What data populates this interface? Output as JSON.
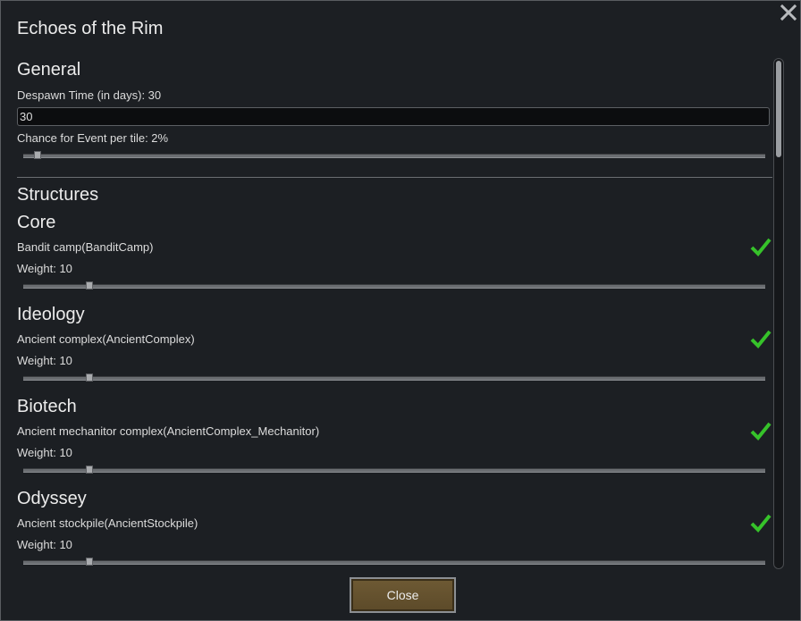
{
  "window": {
    "title": "Echoes of the Rim"
  },
  "general": {
    "heading": "General",
    "despawn_label": "Despawn Time (in days): 30",
    "despawn_value": "30",
    "chance_label": "Chance for Event per tile: 2%",
    "chance_level": 0.02
  },
  "structures": {
    "heading": "Structures",
    "groups": [
      {
        "heading": "Core",
        "item": "Bandit camp(BanditCamp)",
        "weight_label": "Weight: 10",
        "enabled": true
      },
      {
        "heading": "Ideology",
        "item": "Ancient complex(AncientComplex)",
        "weight_label": "Weight: 10",
        "enabled": true
      },
      {
        "heading": "Biotech",
        "item": "Ancient mechanitor complex(AncientComplex_Mechanitor)",
        "weight_label": "Weight: 10",
        "enabled": true
      },
      {
        "heading": "Odyssey",
        "item": "Ancient stockpile(AncientStockpile)",
        "weight_label": "Weight: 10",
        "enabled": true
      }
    ]
  },
  "footer": {
    "close_label": "Close"
  },
  "icons": {
    "close": "close-x-icon",
    "check": "checkmark-icon"
  },
  "colors": {
    "check": "#36c22a",
    "button": "#6e5a34"
  }
}
